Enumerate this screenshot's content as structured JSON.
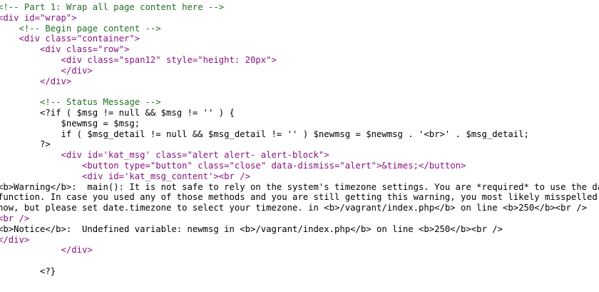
{
  "lines": [
    "<!-- Part 1: Wrap all page content here -->",
    "<div id=\"wrap\">",
    "    <!-- Begin page content -->",
    "    <div class=\"container\">",
    "        <div class=\"row\">",
    "            <div class=\"span12\" style=\"height: 20px\">",
    "            </div>",
    "        </div>",
    "",
    "        <!-- Status Message -->",
    "        <?if ( $msg != null && $msg != '' ) {",
    "            $newmsg = $msg;",
    "            if ( $msg_detail != null && $msg_detail != '' ) $newmsg = $newmsg . '<br>' . $msg_detail;",
    "        ?>",
    "            <div id='kat_msg' class=\"alert alert- alert-block\">",
    "                <button type=\"button\" class=\"close\" data-dismiss=\"alert\">&times;</button>",
    "                <div id='kat_msg_content'><br />",
    "<b>Warning</b>:  main(): It is not safe to rely on the system's timezone settings. You are *required* to use the date.timezone setting or the date_default_timezone_set()",
    "function. In case you used any of those methods and you are still getting this warning, you most likely misspelled the timezone identifier. We selected the timezone 'UTC' for",
    "now, but please set date.timezone to select your timezone. in <b>/vagrant/index.php</b> on line <b>250</b><br />",
    "<br />",
    "<b>Notice</b>:  Undefined variable: newmsg in <b>/vagrant/index.php</b> on line <b>250</b><br />",
    "</div>",
    "            </div>",
    "",
    "        <?}"
  ]
}
